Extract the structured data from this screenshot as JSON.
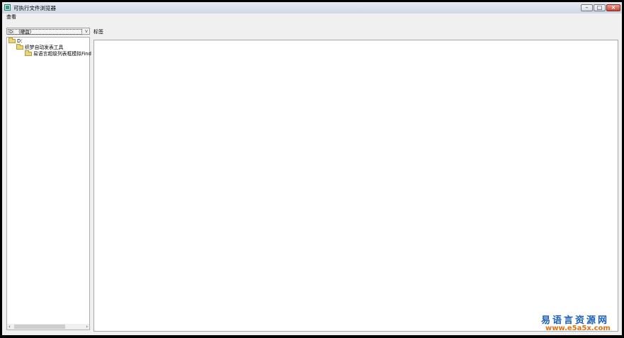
{
  "window": {
    "title": "可执行文件浏览器",
    "controls": {
      "minimize": "–",
      "maximize": "□",
      "close": "×"
    }
  },
  "menu": {
    "items": [
      "查看"
    ]
  },
  "drive_selector": {
    "value": "D: （硬盘）",
    "arrow": "v"
  },
  "content": {
    "tab_label": "标签"
  },
  "tree": {
    "items": [
      {
        "label": "D:"
      },
      {
        "label": "织梦自动发表工具"
      },
      {
        "label": "易语言超级列表框模拟Find"
      }
    ]
  },
  "scrollbar": {
    "left": "‹",
    "right": "›"
  },
  "watermark": {
    "title": "易语言资源网",
    "url": "www.e5a5x.com"
  },
  "colors": {
    "watermark_title": "#1a5fb8",
    "watermark_url": "#e07010",
    "title_bar": "#d8e0ea"
  }
}
